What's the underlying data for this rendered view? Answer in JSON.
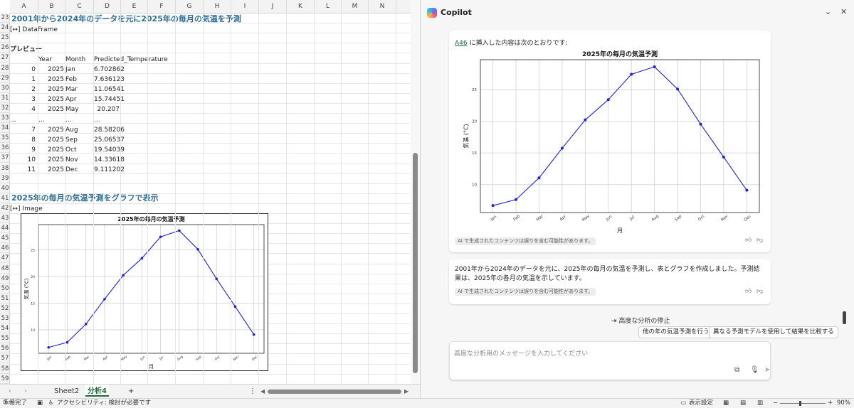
{
  "sheet": {
    "columns": [
      "A",
      "B",
      "C",
      "D",
      "E",
      "F",
      "G",
      "H",
      "I",
      "J",
      "K",
      "L",
      "M",
      "N"
    ],
    "rows": [
      "23",
      "24",
      "25",
      "26",
      "27",
      "28",
      "29",
      "30",
      "31",
      "32",
      "33",
      "34",
      "35",
      "36",
      "37",
      "38",
      "39",
      "40",
      "41",
      "42",
      "43",
      "44",
      "45",
      "46",
      "47",
      "48",
      "49",
      "50",
      "51",
      "52",
      "53",
      "54",
      "55",
      "56",
      "57",
      "58",
      "59"
    ],
    "heading1": "2001年から2024年のデータを元に2025年の毎月の気温を予測",
    "dataframe_label": "[↔] DataFrame",
    "preview_label": "プレビュー",
    "headers": [
      "Year",
      "Month",
      "Predicted_Temperature"
    ],
    "table": [
      {
        "i": "0",
        "y": "2025",
        "m": "Jan",
        "t": "6.702862"
      },
      {
        "i": "1",
        "y": "2025",
        "m": "Feb",
        "t": "7.636123"
      },
      {
        "i": "2",
        "y": "2025",
        "m": "Mar",
        "t": "11.06541"
      },
      {
        "i": "3",
        "y": "2025",
        "m": "Apr",
        "t": "15.74451"
      },
      {
        "i": "4",
        "y": "2025",
        "m": "May",
        "t": "20.207"
      },
      {
        "i": "...",
        "y": "...",
        "m": "...",
        "t": "..."
      },
      {
        "i": "7",
        "y": "2025",
        "m": "Aug",
        "t": "28.58206"
      },
      {
        "i": "8",
        "y": "2025",
        "m": "Sep",
        "t": "25.06537"
      },
      {
        "i": "9",
        "y": "2025",
        "m": "Oct",
        "t": "19.54039"
      },
      {
        "i": "10",
        "y": "2025",
        "m": "Nov",
        "t": "14.33618"
      },
      {
        "i": "11",
        "y": "2025",
        "m": "Dec",
        "t": "9.111202"
      }
    ],
    "heading2": "2025年の毎月の気温予測をグラフで表示",
    "image_label": "[↔] Image",
    "tabs": [
      "Sheet2",
      "分析4"
    ],
    "add_tab": "+"
  },
  "status": {
    "ready": "準備完了",
    "accessibility": "アクセシビリティ: 検討が必要です",
    "view_settings": "表示設定",
    "zoom": "90%"
  },
  "copilot": {
    "title": "Copilot",
    "cell_ref": "A46",
    "inserted_text": " に挿入した内容は次のとおりです:",
    "disclaimer": "AI で生成されたコンテンツは誤りを含む可能性があります。",
    "summary": "2001年から2024年のデータを元に、2025年の毎月の気温を予測し、表とグラフを作成しました。予測結果は、2025年の各月の気温を示しています。",
    "stop_label": "高度な分析の停止",
    "suggestion1": "他の年の気温予測を行う",
    "suggestion2": "異なる予測モデルを使用して結果を比較する",
    "input_placeholder": "高度な分析用のメッセージを入力してください"
  },
  "chart_data": {
    "type": "line",
    "title": "2025年の毎月の気温予測",
    "xlabel": "月",
    "ylabel": "気温 (°C)",
    "categories": [
      "Jan",
      "Feb",
      "Mar",
      "Apr",
      "May",
      "Jun",
      "Jul",
      "Aug",
      "Sep",
      "Oct",
      "Nov",
      "Dec"
    ],
    "values": [
      6.7,
      7.64,
      11.07,
      15.74,
      20.21,
      23.4,
      27.4,
      28.58,
      25.07,
      19.54,
      14.34,
      9.11
    ],
    "yticks": [
      10,
      15,
      20,
      25
    ],
    "ylim": [
      5.6,
      29.7
    ],
    "grid": true,
    "color": "#1f1fe0"
  }
}
